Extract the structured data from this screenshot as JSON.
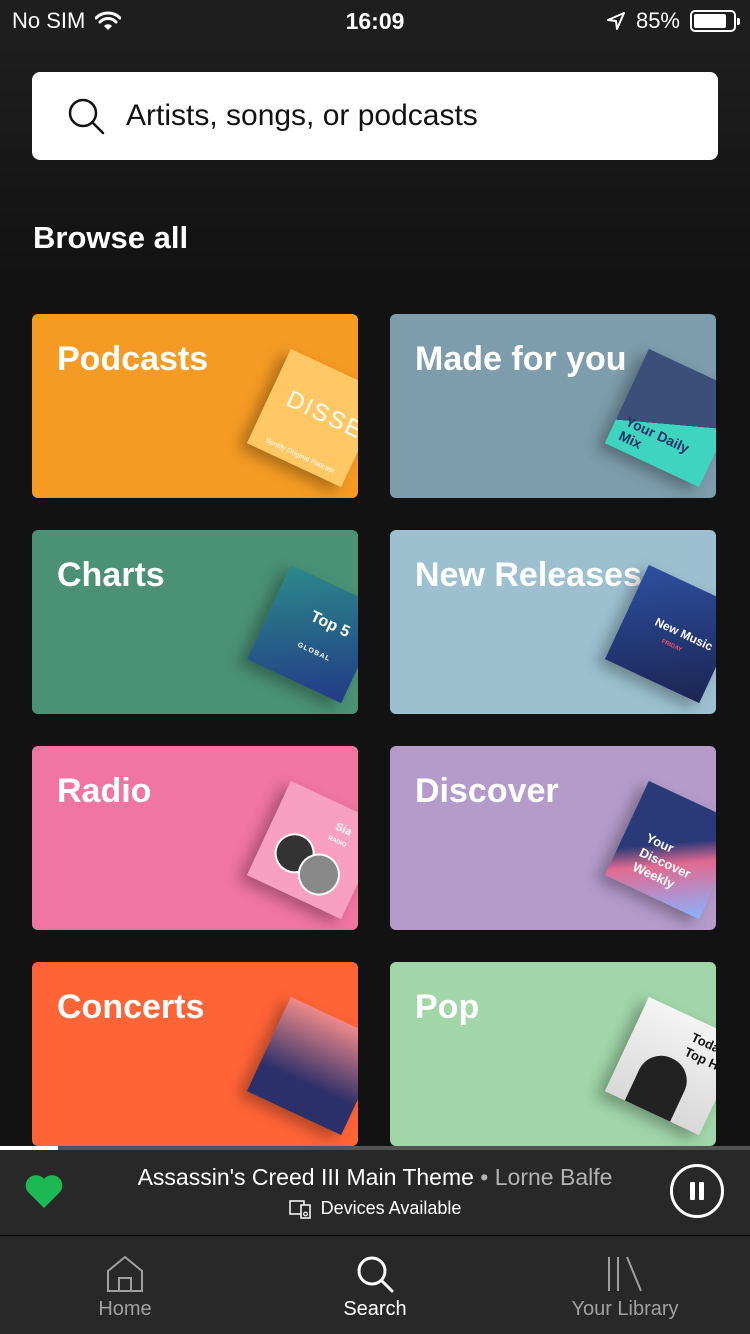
{
  "status_bar": {
    "carrier": "No SIM",
    "time": "16:09",
    "battery": "85%",
    "battery_level": 0.85
  },
  "search": {
    "placeholder": "Artists, songs, or podcasts"
  },
  "browse": {
    "title": "Browse all",
    "tiles": [
      {
        "label": "Podcasts",
        "color": "#f59b23",
        "cover_text": "DISSEC",
        "cover_subtext": "Spotify Original Podcast"
      },
      {
        "label": "Made for you",
        "color": "#7d9cac",
        "cover_text": "Your Daily Mix"
      },
      {
        "label": "Charts",
        "color": "#4a9175",
        "cover_text": "Top 5",
        "cover_subtext": "GLOBAL"
      },
      {
        "label": "New Releases",
        "color": "#9cc0d0",
        "cover_text": "New Music",
        "cover_subtext": "FRIDAY"
      },
      {
        "label": "Radio",
        "color": "#f075a0",
        "cover_text": "Sia",
        "cover_subtext": "RADIO"
      },
      {
        "label": "Discover",
        "color": "#b49bca",
        "cover_text": "Your Discover Weekly"
      },
      {
        "label": "Concerts",
        "color": "#ff6437",
        "cover_text": ""
      },
      {
        "label": "Pop",
        "color": "#a0d6a8",
        "cover_text": "Today's Top H"
      }
    ]
  },
  "mini_player": {
    "track": "Assassin's Creed III Main Theme",
    "separator": " • ",
    "artist": "Lorne Balfe",
    "devices": "Devices Available",
    "progress": 0.077,
    "liked_color": "#1db954"
  },
  "tab_bar": {
    "tabs": [
      {
        "label": "Home",
        "icon": "home-icon"
      },
      {
        "label": "Search",
        "icon": "search-icon"
      },
      {
        "label": "Your Library",
        "icon": "library-icon"
      }
    ],
    "active": "Search"
  }
}
